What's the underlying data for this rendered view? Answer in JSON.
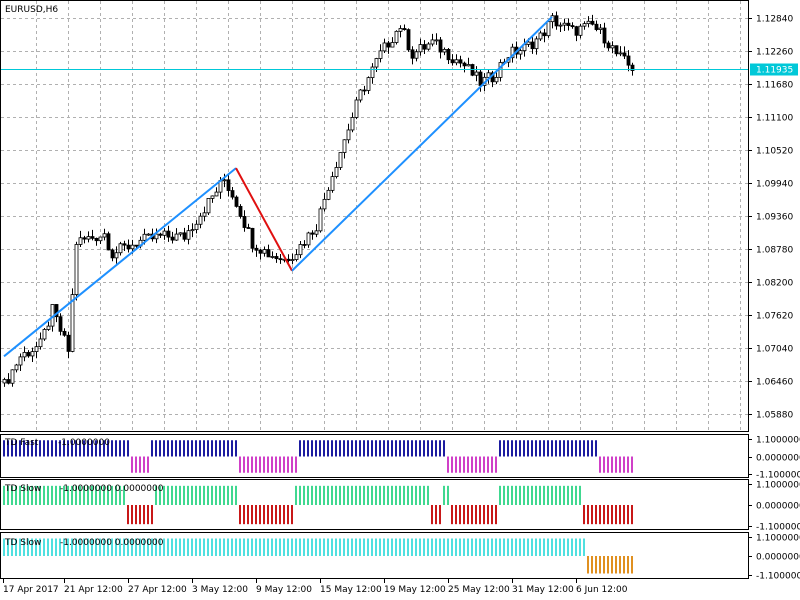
{
  "window": {
    "symbol_title": "EURUSD,H6"
  },
  "main_chart": {
    "price_axis_ticks": [
      "1.12840",
      "1.12260",
      "1.11680",
      "1.11100",
      "1.10520",
      "1.09940",
      "1.09360",
      "1.08780",
      "1.08200",
      "1.07620",
      "1.07040",
      "1.06460",
      "1.05880"
    ],
    "current_price_label": "1.11935",
    "current_price": 1.11935,
    "ylim": [
      1.0559,
      1.1313
    ],
    "colors": {
      "bull": "#000000",
      "bear": "#000000",
      "current_line": "#00c8d8",
      "zigzag_up": "#1e90ff",
      "zigzag_down": "#e01010",
      "grid": "#b0b0b0"
    }
  },
  "panels": [
    {
      "id": "td-fast",
      "title": "TD Fast",
      "values_text": "-1.0000000",
      "axis_ticks": [
        "1.1000000",
        "0.0000000",
        "-1.1000000"
      ],
      "colors": {
        "pos": "#1c1ca0",
        "neg": "#d040c8"
      }
    },
    {
      "id": "td-slow-1",
      "title": "TD Slow",
      "values_text": "-1.0000000 0.0000000",
      "axis_ticks": [
        "1.1000000",
        "0.0000000",
        "-1.1000000"
      ],
      "colors": {
        "pos": "#40d890",
        "neg": "#c81818"
      }
    },
    {
      "id": "td-slow-2",
      "title": "TD Slow",
      "values_text": "-1.0000000 0.0000000",
      "axis_ticks": [
        "1.1000000",
        "0.0000000",
        "-1.1000000"
      ],
      "colors": {
        "pos": "#50e0e0",
        "neg": "#e09020"
      }
    }
  ],
  "time_axis_labels": [
    "17 Apr 2017",
    "21 Apr 12:00",
    "27 Apr 12:00",
    "3 May 12:00",
    "9 May 12:00",
    "15 May 12:00",
    "19 May 12:00",
    "25 May 12:00",
    "31 May 12:00",
    "6 Jun 12:00"
  ],
  "chart_data": {
    "type": "candlestick",
    "symbol": "EURUSD",
    "timeframe": "H6",
    "close_path_anchors": [
      [
        0,
        1.064
      ],
      [
        4,
        1.069
      ],
      [
        9,
        1.071
      ],
      [
        12,
        1.077
      ],
      [
        16,
        1.07
      ],
      [
        18,
        1.089
      ],
      [
        25,
        1.0905
      ],
      [
        27,
        1.087
      ],
      [
        33,
        1.089
      ],
      [
        39,
        1.09
      ],
      [
        45,
        1.09
      ],
      [
        51,
        1.096
      ],
      [
        55,
        1.1
      ],
      [
        58,
        1.096
      ],
      [
        62,
        1.089
      ],
      [
        66,
        1.087
      ],
      [
        70,
        1.086
      ],
      [
        73,
        1.0875
      ],
      [
        78,
        1.092
      ],
      [
        81,
        1.099
      ],
      [
        85,
        1.107
      ],
      [
        89,
        1.115
      ],
      [
        94,
        1.122
      ],
      [
        99,
        1.127
      ],
      [
        102,
        1.122
      ],
      [
        107,
        1.124
      ],
      [
        111,
        1.122
      ],
      [
        115,
        1.12
      ],
      [
        119,
        1.117
      ],
      [
        122,
        1.118
      ],
      [
        126,
        1.122
      ],
      [
        130,
        1.123
      ],
      [
        134,
        1.125
      ],
      [
        137,
        1.128
      ],
      [
        142,
        1.126
      ],
      [
        147,
        1.127
      ],
      [
        150,
        1.125
      ],
      [
        153,
        1.122
      ],
      [
        156,
        1.12
      ],
      [
        158,
        1.1193
      ]
    ],
    "zigzag": [
      {
        "from": [
          0,
          1.069
        ],
        "to": [
          58,
          1.102
        ],
        "dir": "up"
      },
      {
        "from": [
          58,
          1.102
        ],
        "to": [
          72,
          1.084
        ],
        "dir": "down"
      },
      {
        "from": [
          72,
          1.084
        ],
        "to": [
          137,
          1.1285
        ],
        "dir": "up"
      }
    ],
    "indicators": {
      "td_fast": [
        [
          0,
          31,
          1
        ],
        [
          32,
          36,
          -1
        ],
        [
          37,
          58,
          1
        ],
        [
          59,
          73,
          -1
        ],
        [
          74,
          110,
          1
        ],
        [
          111,
          123,
          -1
        ],
        [
          124,
          148,
          1
        ],
        [
          149,
          157,
          -1
        ]
      ],
      "td_slow_1": [
        [
          0,
          30,
          1
        ],
        [
          31,
          37,
          -1
        ],
        [
          38,
          58,
          1
        ],
        [
          59,
          72,
          -1
        ],
        [
          73,
          106,
          1
        ],
        [
          107,
          109,
          -1
        ],
        [
          110,
          111,
          1
        ],
        [
          112,
          123,
          -1
        ],
        [
          124,
          144,
          1
        ],
        [
          145,
          157,
          -1
        ]
      ],
      "td_slow_2": [
        [
          0,
          145,
          1
        ],
        [
          146,
          157,
          -1
        ]
      ]
    }
  }
}
